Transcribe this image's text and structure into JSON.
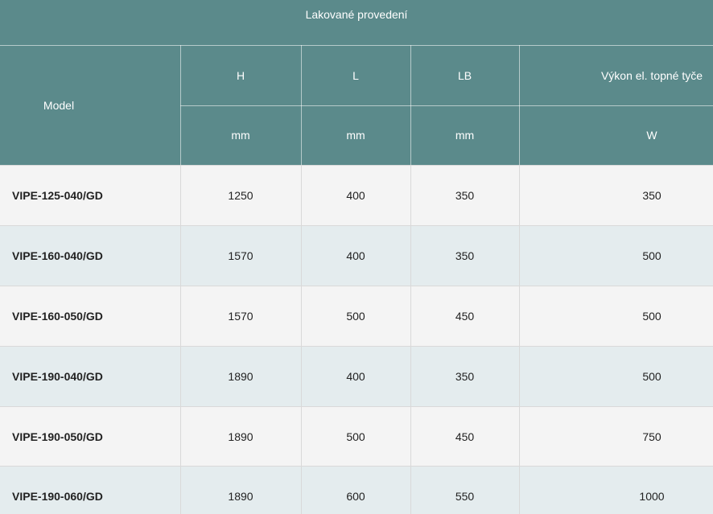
{
  "table": {
    "group_header": "Lakované provedení",
    "headers": {
      "model": "Model",
      "h": "H",
      "l": "L",
      "lb": "LB",
      "power": "Výkon el. topné tyče"
    },
    "units": {
      "h": "mm",
      "l": "mm",
      "lb": "mm",
      "power": "W"
    },
    "rows": [
      {
        "model": "VIPE-125-040/GD",
        "h": "1250",
        "l": "400",
        "lb": "350",
        "power": "350"
      },
      {
        "model": "VIPE-160-040/GD",
        "h": "1570",
        "l": "400",
        "lb": "350",
        "power": "500"
      },
      {
        "model": "VIPE-160-050/GD",
        "h": "1570",
        "l": "500",
        "lb": "450",
        "power": "500"
      },
      {
        "model": "VIPE-190-040/GD",
        "h": "1890",
        "l": "400",
        "lb": "350",
        "power": "500"
      },
      {
        "model": "VIPE-190-050/GD",
        "h": "1890",
        "l": "500",
        "lb": "450",
        "power": "750"
      },
      {
        "model": "VIPE-190-060/GD",
        "h": "1890",
        "l": "600",
        "lb": "550",
        "power": "1000"
      }
    ]
  },
  "colors": {
    "header_bg": "#5b8a8b",
    "row_odd": "#f4f4f4",
    "row_even": "#e4ecee"
  }
}
